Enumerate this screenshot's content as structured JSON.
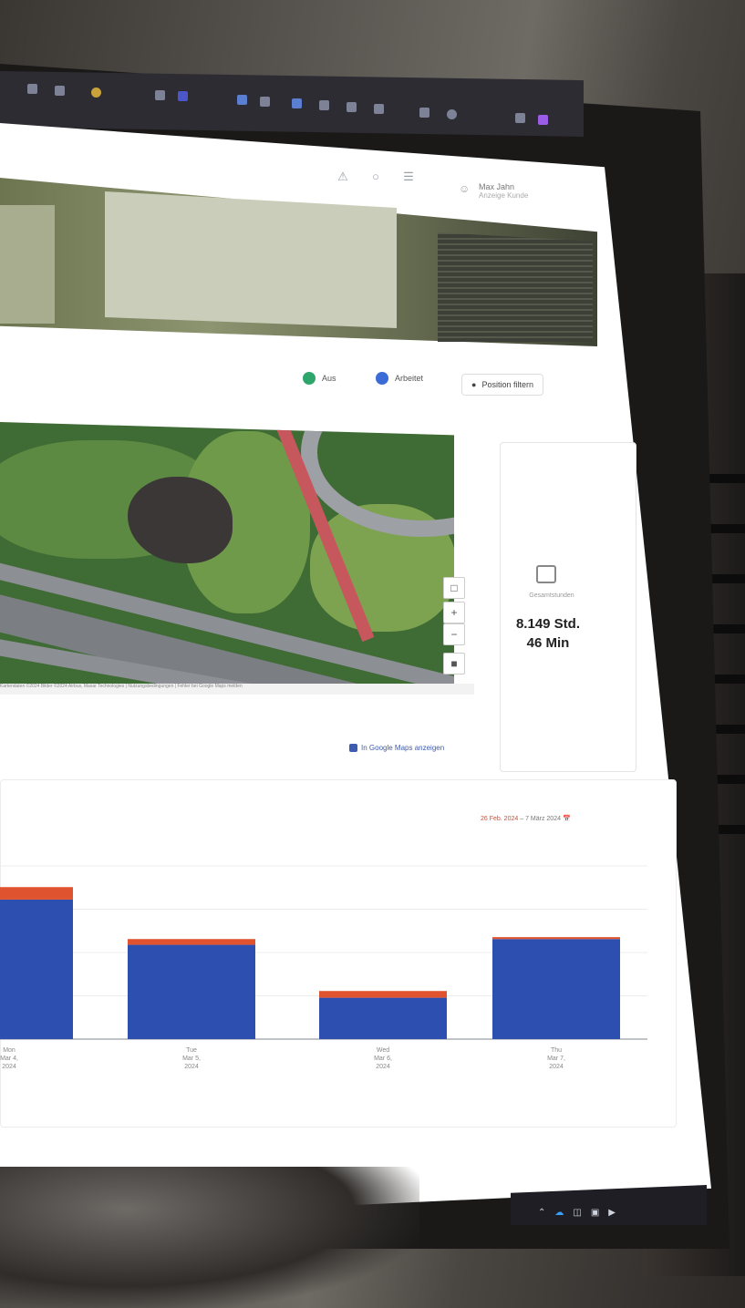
{
  "header": {
    "icons": [
      "bell-icon",
      "help-icon",
      "menu-icon"
    ],
    "notification_count": "0",
    "user_name": "Max Jahn",
    "user_company": "Anzeige Kunde"
  },
  "legend": {
    "items": [
      {
        "label": "Aus",
        "color": "#2ea56b"
      },
      {
        "label": "Arbeitet",
        "color": "#3b6bd6"
      }
    ],
    "button_label": "Position filtern"
  },
  "map": {
    "attribution": "Kartendaten ©2024 Bilder ©2024 Airbus, Maxar Technologies | Nutzungsbedingungen | Fehler bei Google Maps melden",
    "google_maps_link": "In Google Maps anzeigen"
  },
  "stat": {
    "label": "Gesamtstunden",
    "value_line1": "8.149 Std.",
    "value_line2": "46 Min"
  },
  "date_range": {
    "start": "26 Feb. 2024",
    "separator": "–",
    "end": "7 März 2024"
  },
  "chart_data": {
    "type": "bar",
    "categories": [
      "Mon\nMar 4,\n2024",
      "Tue\nMar 5,\n2024",
      "Wed\nMar 6,\n2024",
      "Thu\nMar 7,\n2024"
    ],
    "series": [
      {
        "values": [
          14.5,
          9.8,
          4.3,
          10.4
        ],
        "color": "#2c4fb0"
      },
      {
        "values": [
          1.3,
          0.6,
          0.7,
          0.2
        ],
        "color": "#e0532f"
      }
    ],
    "ylim": [
      0,
      18
    ],
    "grid": true
  }
}
